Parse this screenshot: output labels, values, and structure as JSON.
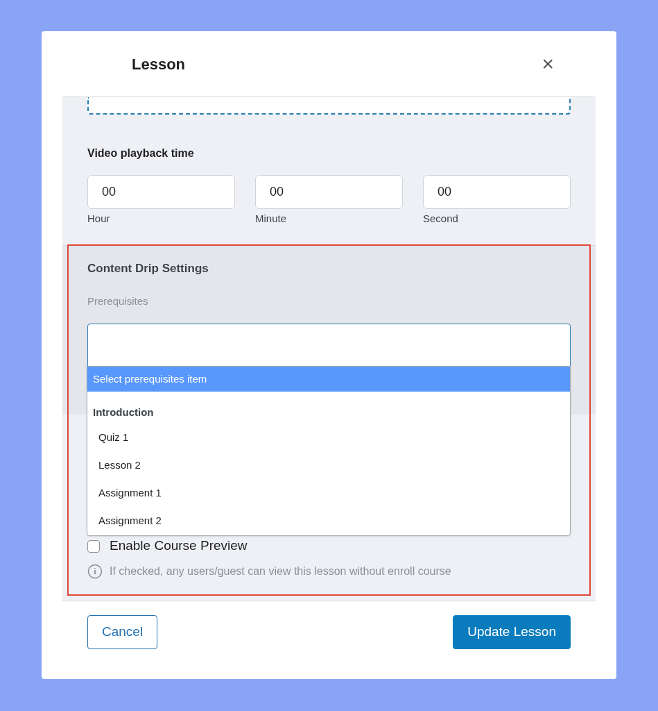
{
  "dialog": {
    "title": "Lesson",
    "close_label": "×"
  },
  "playback": {
    "label": "Video playback time",
    "fields": [
      {
        "value": "00",
        "caption": "Hour"
      },
      {
        "value": "00",
        "caption": "Minute"
      },
      {
        "value": "00",
        "caption": "Second"
      }
    ]
  },
  "content_drip": {
    "title": "Content Drip Settings",
    "prerequisites_label": "Prerequisites",
    "dropdown_open": true,
    "options": [
      {
        "kind": "prompt",
        "label": "Select prerequisites item",
        "selected": true
      },
      {
        "kind": "group",
        "label": "Introduction",
        "selected": false
      },
      {
        "kind": "item",
        "label": "Quiz 1",
        "selected": false
      },
      {
        "kind": "item",
        "label": "Lesson 2",
        "selected": false
      },
      {
        "kind": "item",
        "label": "Assignment 1",
        "selected": false
      },
      {
        "kind": "item",
        "label": "Assignment 2",
        "selected": false
      }
    ]
  },
  "course_preview": {
    "label": "Enable Course Preview",
    "checked": false,
    "hint": "If checked, any users/guest can view this lesson without enroll course"
  },
  "highlighted": true,
  "buttons": [
    {
      "kind": "secondary",
      "label": "Cancel"
    },
    {
      "kind": "primary",
      "label": "Update Lesson"
    }
  ]
}
